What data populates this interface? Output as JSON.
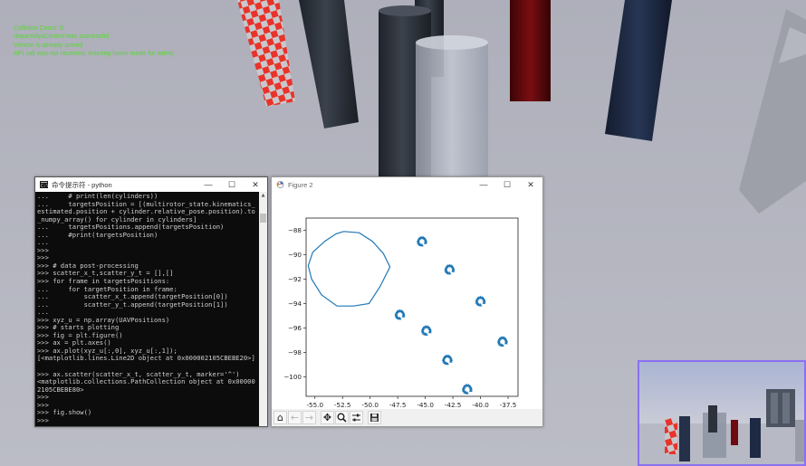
{
  "hud": {
    "lines": [
      "Collision Count: 0",
      "requestApiControl was successful",
      "Vehicle is already armed",
      "API call was not received, entering hover mode for safety"
    ]
  },
  "terminal": {
    "title": "命令提示符 - python",
    "code": "...     # print(len(cylinders))\n...     targetsPosition = [(multirotor_state.kinematics_\nestimated.position + cylinder.relative_pose.position).to\n_numpy_array() for cylinder in cylinders]\n...     targetsPositions.append(targetsPosition)\n...     #print(targetsPosition)\n...\n>>>\n>>>\n>>> # data post-processing\n>>> scatter_x_t,scatter_y_t = [],[]\n>>> for frame in targetsPositions:\n...     for targetPosition in frame:\n...         scatter_x_t.append(targetPosition[0])\n...         scatter_y_t.append(targetPosition[1])\n...\n>>> xyz_u = np.array(UAVPositions)\n>>> # starts plotting\n>>> fig = plt.figure()\n>>> ax = plt.axes()\n>>> ax.plot(xyz_u[:,0], xyz_u[:,1]);\n[<matplotlib.lines.Line2D object at 0x000002105CBEBE20>]\n\n>>> ax.scatter(scatter_x_t, scatter_y_t, marker='^')\n<matplotlib.collections.PathCollection object at 0x00000\n2105CBEBE80>\n>>>\n>>>\n>>> fig.show()\n>>>"
  },
  "figure": {
    "title": "Figure 2",
    "toolbar": [
      "home-icon",
      "back-icon",
      "forward-icon",
      "pan-icon",
      "zoom-icon",
      "configure-icon",
      "save-icon"
    ]
  },
  "window_buttons": {
    "minimize": "—",
    "maximize": "☐",
    "close": "✕"
  },
  "chart_data": {
    "type": "line",
    "xlim": [
      -55.8,
      -36.6
    ],
    "ylim": [
      -101.6,
      -87.0
    ],
    "xticks": [
      -55.0,
      -52.5,
      -50.0,
      -47.5,
      -45.0,
      -42.5,
      -40.0,
      -37.5
    ],
    "yticks": [
      -88,
      -90,
      -92,
      -94,
      -96,
      -98,
      -100
    ],
    "xtick_labels": [
      "-55.0",
      "-52.5",
      "-50.0",
      "-47.5",
      "-45.0",
      "-42.5",
      "-40.0",
      "-37.5"
    ],
    "ytick_labels": [
      "−88",
      "−90",
      "−92",
      "−94",
      "−96",
      "−98",
      "−100"
    ],
    "grid": false,
    "line_color": "#1f77b4",
    "line": {
      "x": [
        -52.4,
        -51.0,
        -49.8,
        -48.8,
        -48.2,
        -49.1,
        -50.1,
        -51.5,
        -53.0,
        -54.4,
        -55.3,
        -55.6,
        -55.2,
        -54.1,
        -53.1,
        -52.4
      ],
      "y": [
        -88.1,
        -88.2,
        -88.9,
        -89.9,
        -91.0,
        -92.6,
        -94.0,
        -94.2,
        -94.2,
        -93.3,
        -92.0,
        -90.9,
        -89.8,
        -88.9,
        -88.3,
        -88.1
      ]
    },
    "scatter": {
      "marker": "^",
      "color": "#1f77b4",
      "clusters": [
        {
          "x": -45.3,
          "y": -88.9
        },
        {
          "x": -42.8,
          "y": -91.2
        },
        {
          "x": -40.0,
          "y": -93.8
        },
        {
          "x": -47.3,
          "y": -94.9
        },
        {
          "x": -44.9,
          "y": -96.2
        },
        {
          "x": -38.0,
          "y": -97.1
        },
        {
          "x": -43.0,
          "y": -98.6
        },
        {
          "x": -41.2,
          "y": -101.0
        }
      ]
    }
  }
}
